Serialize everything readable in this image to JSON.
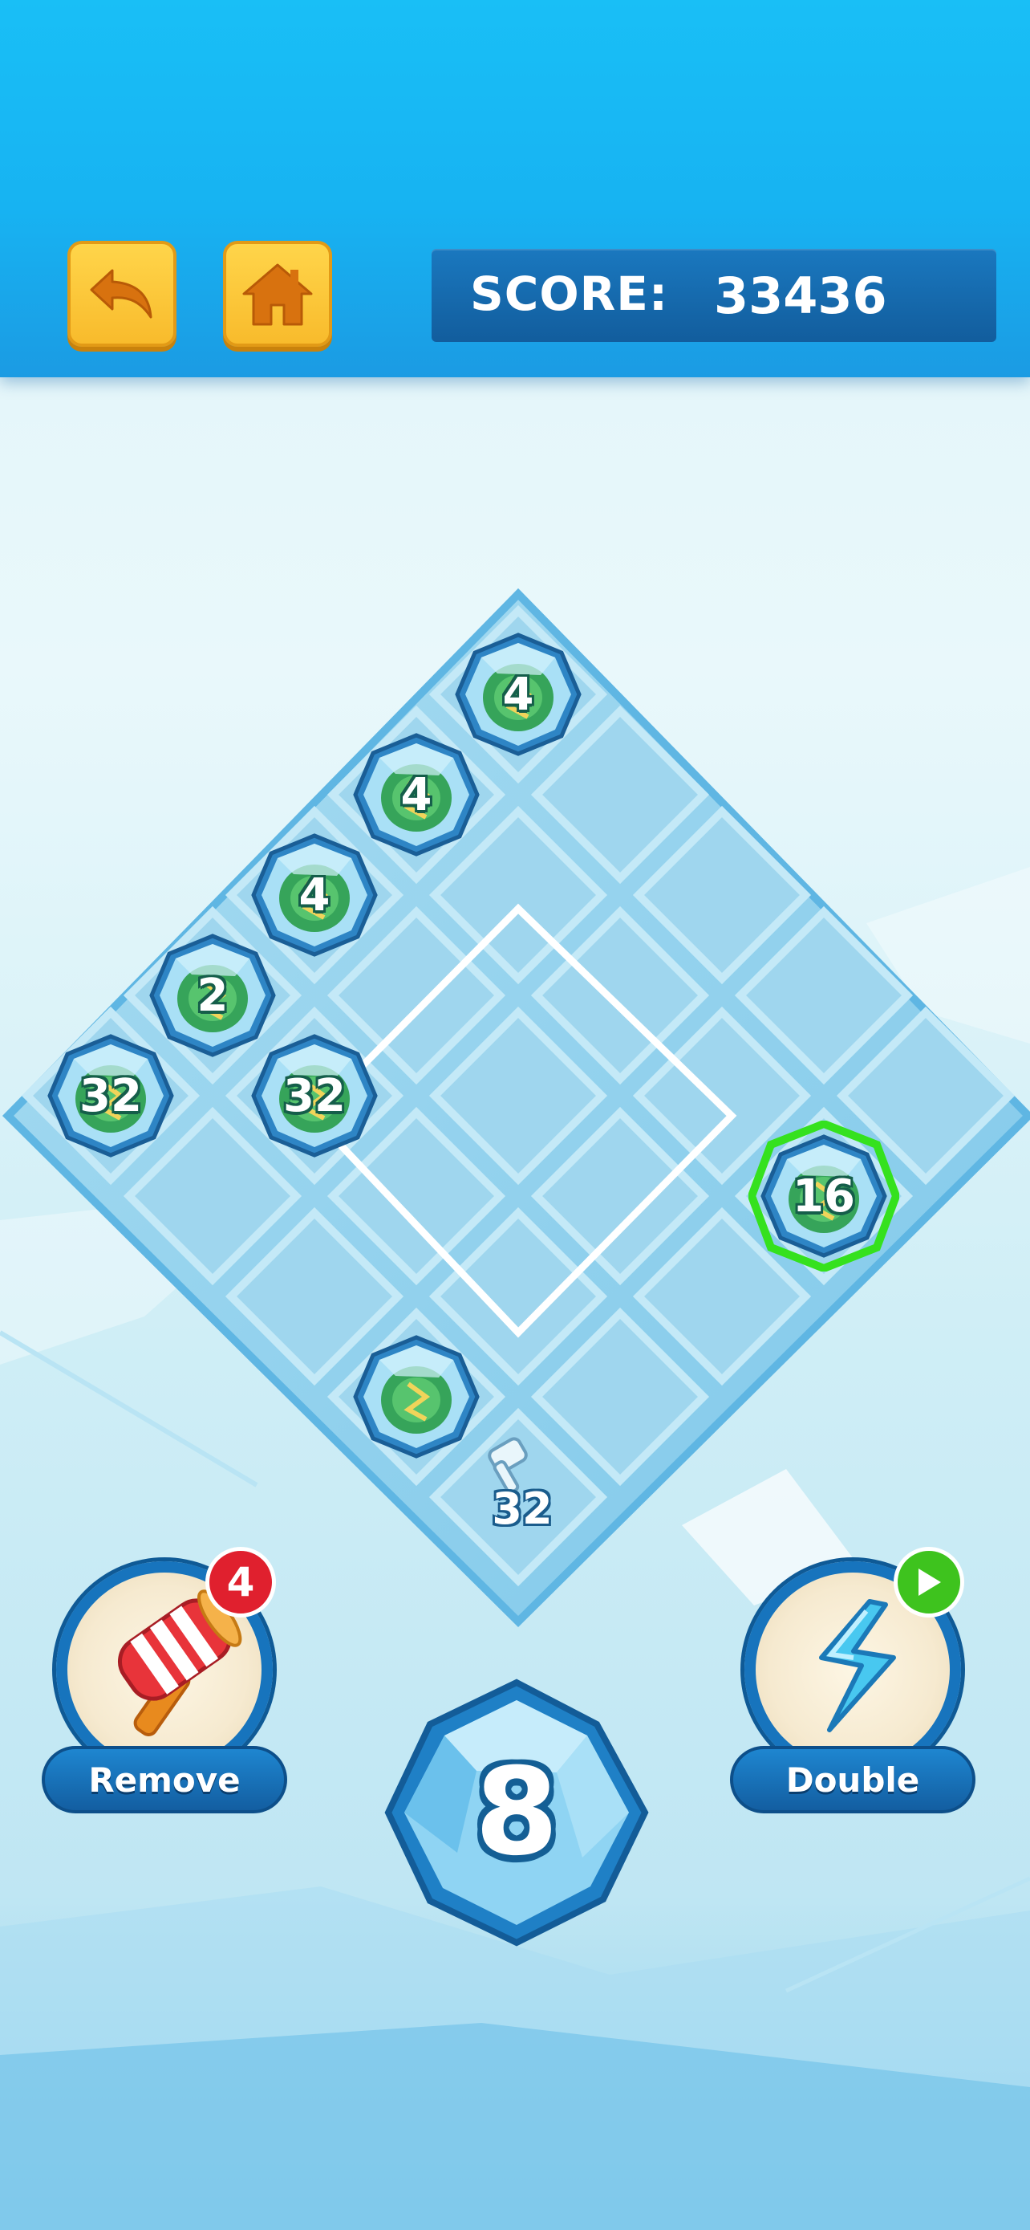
{
  "header": {
    "back_icon": "undo-arrow-icon",
    "home_icon": "home-icon",
    "score_label": "SCORE:",
    "score_value": "33436"
  },
  "board": {
    "grid_size": 5,
    "tiles": [
      {
        "row": 0,
        "col": 0,
        "value": "4"
      },
      {
        "row": 1,
        "col": 0,
        "value": "4"
      },
      {
        "row": 2,
        "col": 0,
        "value": "4"
      },
      {
        "row": 3,
        "col": 0,
        "value": "2"
      },
      {
        "row": 4,
        "col": 0,
        "value": "32"
      },
      {
        "row": 3,
        "col": 1,
        "value": "32"
      },
      {
        "row": 1,
        "col": 4,
        "value": "16",
        "highlighted": true
      },
      {
        "row": 4,
        "col": 3,
        "value": ""
      }
    ],
    "hint_value": "32",
    "hint_icon": "hammer-icon"
  },
  "powerups": {
    "remove": {
      "label": "Remove",
      "count": "4",
      "icon": "hammer-icon",
      "badge_color": "#e0202e"
    },
    "double": {
      "label": "Double",
      "icon": "lightning-bolt-icon",
      "badge_icon": "play-icon",
      "badge_color": "#3ec31e"
    }
  },
  "next_tile": {
    "value": "8"
  },
  "colors": {
    "header": "#19bff6",
    "score_panel": "#1a78bf",
    "button_yellow": "#f8bb2c",
    "tile_green": "#2f9e4f",
    "highlight": "#35e11e"
  }
}
